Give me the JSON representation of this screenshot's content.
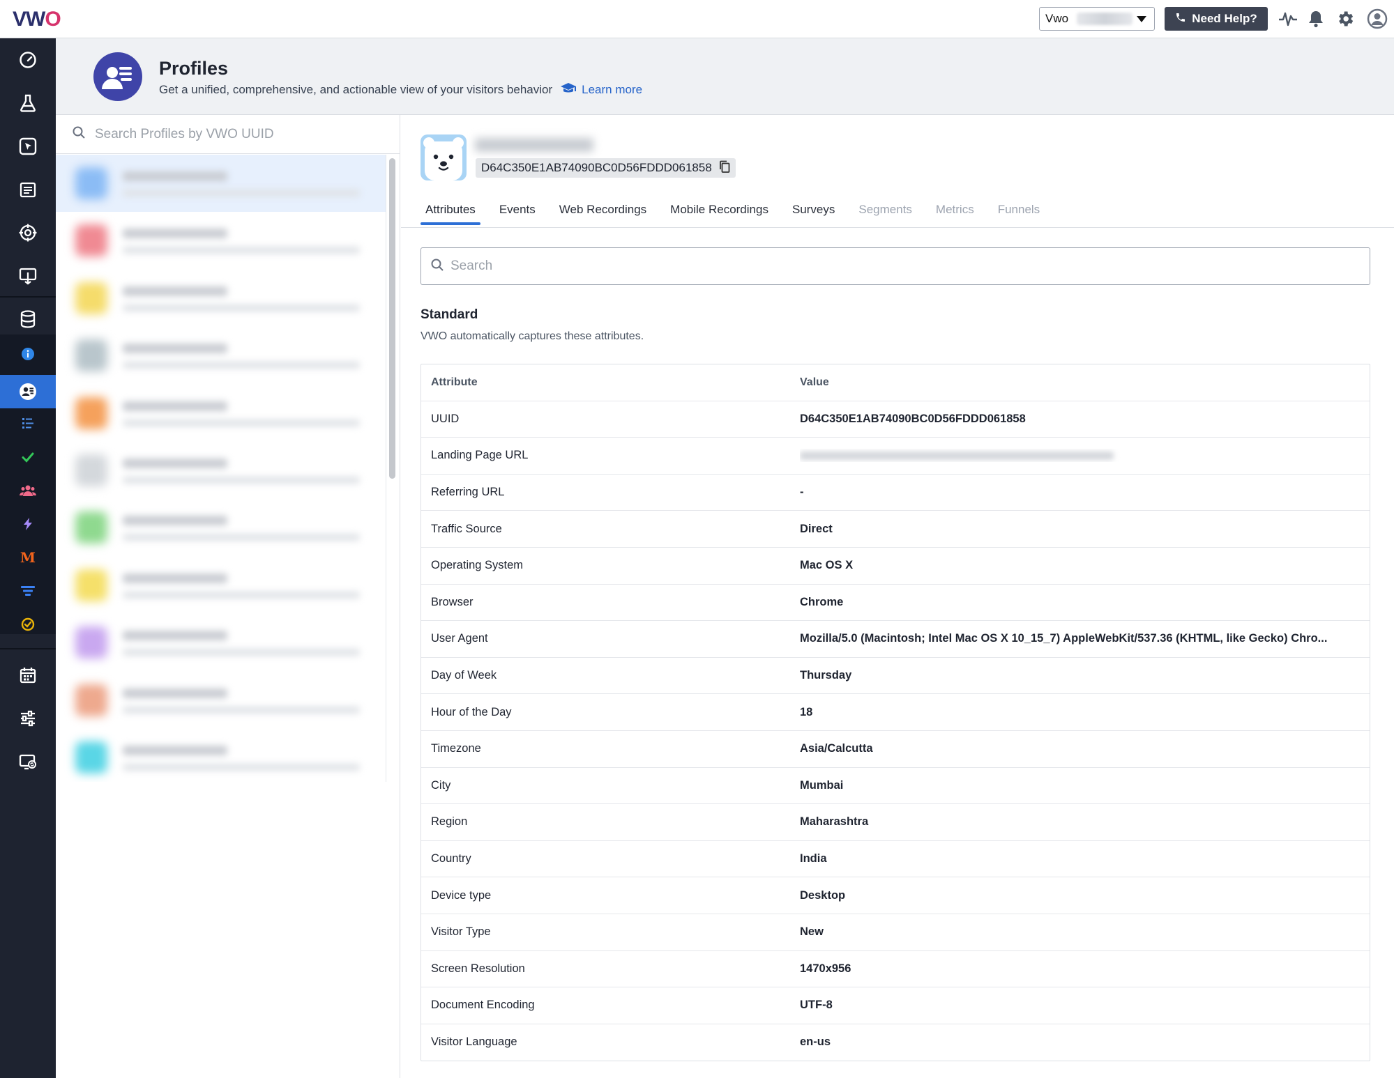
{
  "app": {
    "logo_text_v": "VW",
    "logo_text_o": "O"
  },
  "topbar": {
    "account_label": "Vwo",
    "help_label": "Need Help?",
    "icons": [
      "activity-icon",
      "bell-icon",
      "gear-icon",
      "user-avatar-icon"
    ]
  },
  "leftnav": {
    "items": [
      "dashboard-icon",
      "flask-icon",
      "cursor-click-icon",
      "report-icon",
      "target-icon",
      "presentation-icon",
      "database-icon",
      "info-icon",
      "profile-icon",
      "list-icon",
      "check-icon",
      "users-icon",
      "bolt-icon",
      "m-icon",
      "funnel-icon",
      "goal-icon",
      "calendar-icon",
      "sliders-icon",
      "screen-sync-icon"
    ],
    "m_letter": "M",
    "active": "profile-icon"
  },
  "header": {
    "title": "Profiles",
    "subtitle": "Get a unified, comprehensive, and actionable view of your visitors behavior",
    "learn_more": "Learn more"
  },
  "list": {
    "search_placeholder": "Search Profiles by VWO UUID",
    "avatar_colors": [
      "#8bbcf5",
      "#f08a93",
      "#f5dc6b",
      "#b9c6cc",
      "#f5a15c",
      "#d4d8dc",
      "#8fd98f",
      "#f5e06a",
      "#c9a8f0",
      "#eea98e",
      "#5ad6e6"
    ]
  },
  "profile": {
    "uuid": "D64C350E1AB74090BC0D56FDDD061858"
  },
  "tabs": [
    {
      "label": "Attributes",
      "state": "active"
    },
    {
      "label": "Events",
      "state": "normal"
    },
    {
      "label": "Web Recordings",
      "state": "normal"
    },
    {
      "label": "Mobile Recordings",
      "state": "normal"
    },
    {
      "label": "Surveys",
      "state": "normal"
    },
    {
      "label": "Segments",
      "state": "disabled"
    },
    {
      "label": "Metrics",
      "state": "disabled"
    },
    {
      "label": "Funnels",
      "state": "disabled"
    }
  ],
  "attributes": {
    "search_placeholder": "Search",
    "section_title": "Standard",
    "section_desc": "VWO automatically captures these attributes.",
    "col_attribute": "Attribute",
    "col_value": "Value",
    "rows": [
      {
        "key": "UUID",
        "value": "D64C350E1AB74090BC0D56FDDD061858"
      },
      {
        "key": "Landing Page URL",
        "value": "",
        "blurred": true
      },
      {
        "key": "Referring URL",
        "value": "-"
      },
      {
        "key": "Traffic Source",
        "value": "Direct"
      },
      {
        "key": "Operating System",
        "value": "Mac OS X"
      },
      {
        "key": "Browser",
        "value": "Chrome"
      },
      {
        "key": "User Agent",
        "value": "Mozilla/5.0 (Macintosh; Intel Mac OS X 10_15_7) AppleWebKit/537.36 (KHTML, like Gecko) Chro..."
      },
      {
        "key": "Day of Week",
        "value": "Thursday"
      },
      {
        "key": "Hour of the Day",
        "value": "18"
      },
      {
        "key": "Timezone",
        "value": "Asia/Calcutta"
      },
      {
        "key": "City",
        "value": "Mumbai"
      },
      {
        "key": "Region",
        "value": "Maharashtra"
      },
      {
        "key": "Country",
        "value": "India"
      },
      {
        "key": "Device type",
        "value": "Desktop"
      },
      {
        "key": "Visitor Type",
        "value": "New"
      },
      {
        "key": "Screen Resolution",
        "value": "1470x956"
      },
      {
        "key": "Document Encoding",
        "value": "UTF-8"
      },
      {
        "key": "Visitor Language",
        "value": "en-us"
      }
    ]
  },
  "colors": {
    "accent": "#2d6fd6",
    "nav_bg": "#1e2330",
    "header_bg": "#eff1f4",
    "brand_pink": "#d6336c",
    "brand_navy": "#2b2f6b"
  }
}
